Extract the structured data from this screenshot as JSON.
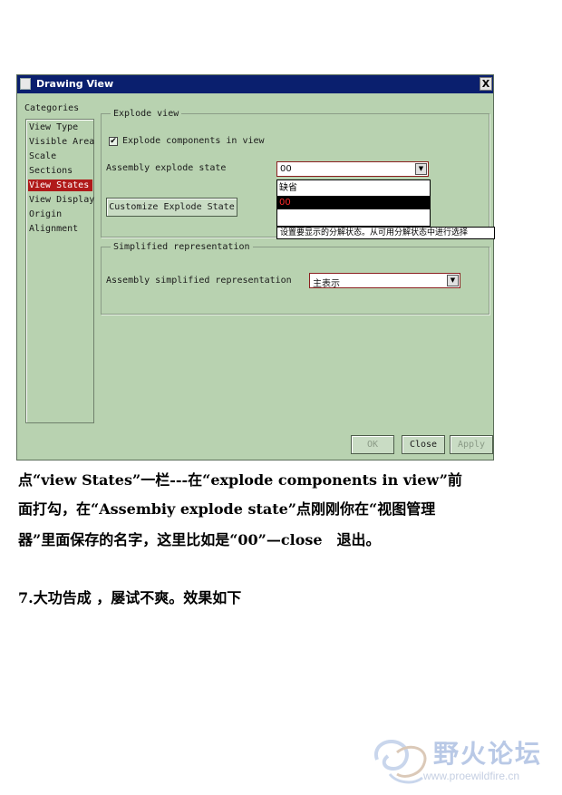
{
  "dialog": {
    "title": "Drawing View",
    "close_glyph": "X",
    "categories_label": "Categories",
    "categories": [
      {
        "label": "View Type",
        "selected": false
      },
      {
        "label": "Visible Area",
        "selected": false
      },
      {
        "label": "Scale",
        "selected": false
      },
      {
        "label": "Sections",
        "selected": false
      },
      {
        "label": "View States",
        "selected": true
      },
      {
        "label": "View Display",
        "selected": false
      },
      {
        "label": "Origin",
        "selected": false
      },
      {
        "label": "Alignment",
        "selected": false
      }
    ],
    "explode_group": {
      "title": "Explode view",
      "checkbox_label": "Explode components in view",
      "checkbox_checked": true,
      "check_glyph": "✔",
      "state_label": "Assembly explode state",
      "state_value": "00",
      "dropdown_options": [
        "缺省",
        "00"
      ],
      "selected_option": "00",
      "tooltip": "设置要显示的分解状态。从可用分解状态中进行选择",
      "customize_button": "Customize Explode State"
    },
    "simplified_group": {
      "title": "Simplified representation",
      "rep_label": "Assembly simplified representation",
      "rep_value": "主表示"
    },
    "buttons": {
      "ok": "OK",
      "close": "Close",
      "apply": "Apply"
    },
    "arrow_glyph": "▼"
  },
  "text": {
    "line1": "点“view States”一栏---在“explode components in view”前",
    "line2": "面打勾，在“Assembiy explode state”点刚刚你在“视图管理",
    "line3": "器”里面保存的名字，这里比如是“00”—close　退出。",
    "line4": "7.大功告成 ，屡试不爽。效果如下"
  },
  "watermark": {
    "cn": "野火论坛",
    "url": "www.proewildfire.cn"
  }
}
